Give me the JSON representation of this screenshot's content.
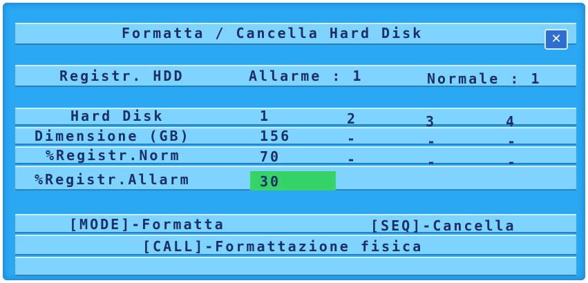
{
  "title": "Formatta / Cancella Hard Disk",
  "close_icon": "x-close-icon",
  "hdd_record": {
    "label": "Registr. HDD",
    "alarm": "Allarme : 1",
    "normal": "Normale : 1"
  },
  "table": {
    "rows": [
      {
        "label": "Hard Disk",
        "values": [
          "1",
          "2",
          "3",
          "4"
        ]
      },
      {
        "label": "Dimensione (GB)",
        "values": [
          "156",
          "-",
          "-",
          "-"
        ]
      },
      {
        "label": "%Registr.Norm",
        "values": [
          "70",
          "-",
          "-",
          "-"
        ]
      },
      {
        "label": "%Registr.Allarm",
        "values": [
          "30"
        ]
      }
    ]
  },
  "actions": {
    "format": "[MODE]-Formatta",
    "delete": "[SEQ]-Cancella",
    "physical_format": "[CALL]-Formattazione fisica"
  },
  "colors": {
    "background": "#2aa8f2",
    "row": "#7fd3ff",
    "selected": "#35d368",
    "text": "#1a2f68"
  }
}
